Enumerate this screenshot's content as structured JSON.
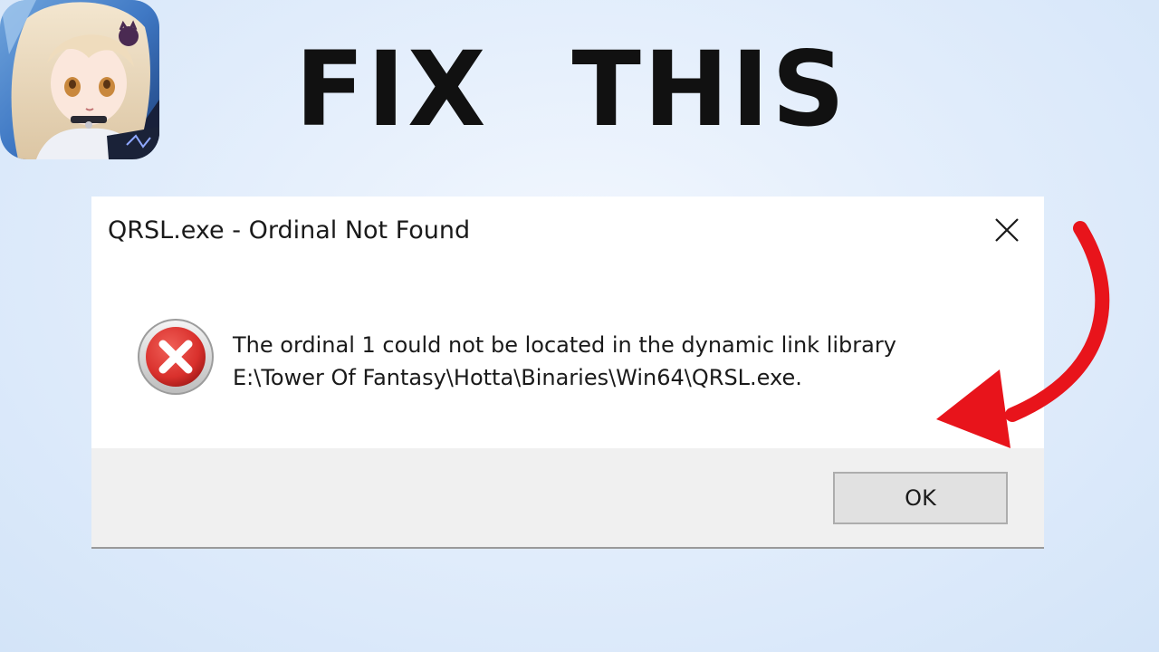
{
  "headline": {
    "word1": "FIX",
    "word2": "THIS"
  },
  "app_icon": {
    "name": "game-app-icon"
  },
  "dialog": {
    "title": "QRSL.exe - Ordinal Not Found",
    "icon": "error-icon",
    "message_line1": "The ordinal 1 could not be located in the dynamic link library",
    "message_line2": "E:\\Tower Of Fantasy\\Hotta\\Binaries\\Win64\\QRSL.exe.",
    "ok_label": "OK",
    "close_icon": "close-icon"
  },
  "annotation": {
    "arrow_color": "#e8141b",
    "arrow_icon": "red-arrow-icon"
  },
  "colors": {
    "background": "#e0ecfb",
    "error_red": "#d9302c",
    "headline": "#111111"
  }
}
